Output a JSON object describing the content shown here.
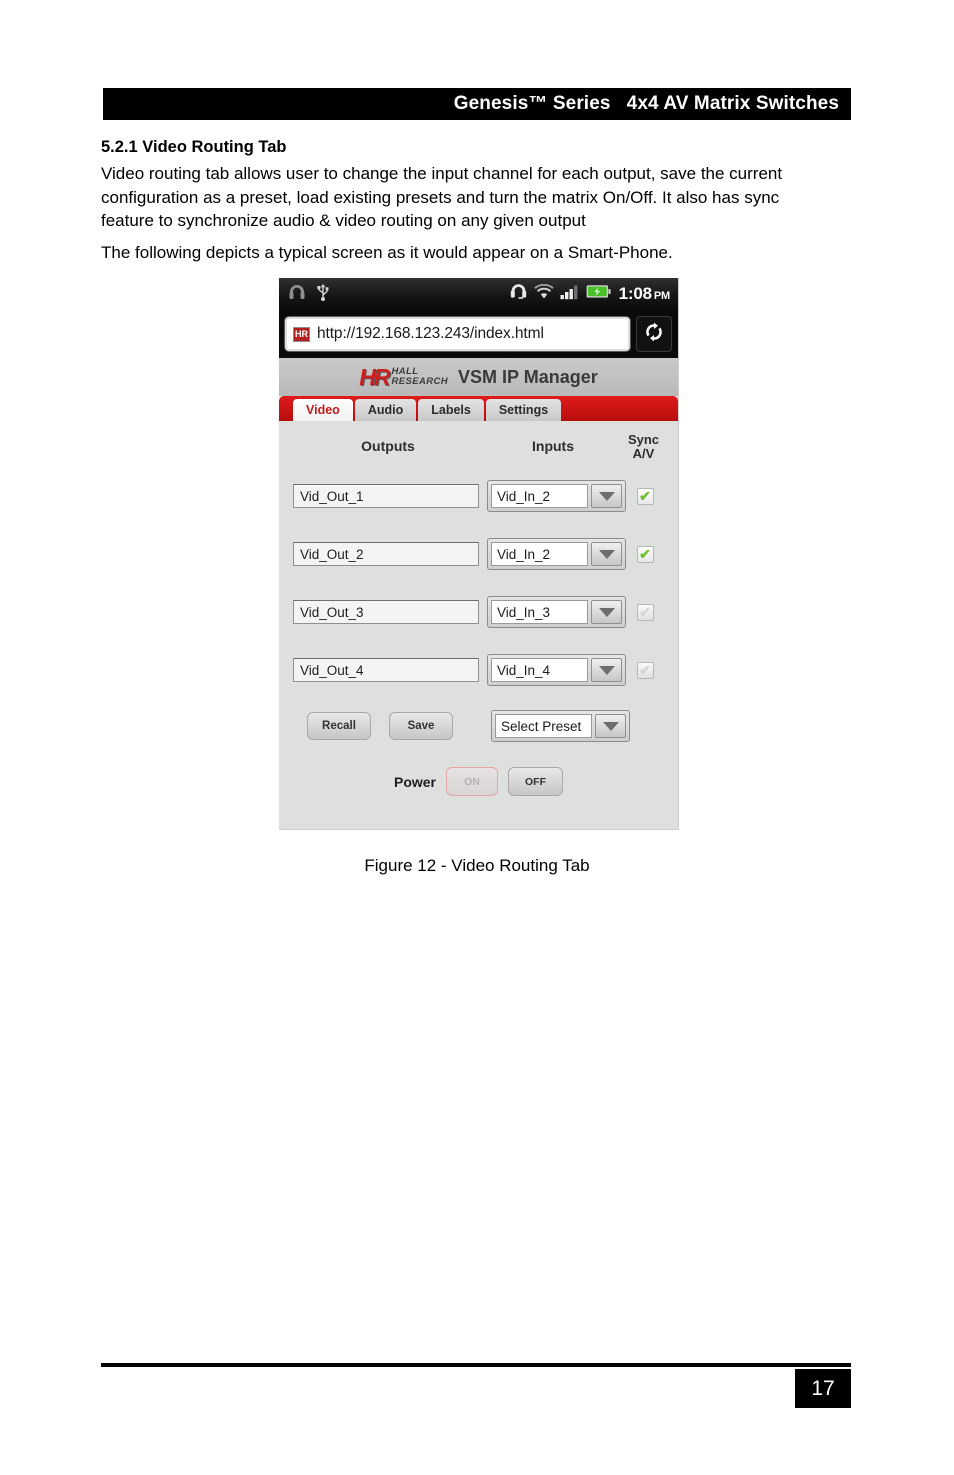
{
  "document": {
    "header_title": "Genesis™ Series   4x4 AV Matrix Switches",
    "section_heading": "5.2.1 Video Routing Tab",
    "paragraph_1": "Video routing tab allows user to change the input channel for each output, save the current configuration as a preset, load existing presets and turn the matrix On/Off. It also has sync feature to synchronize audio & video routing on any given output",
    "paragraph_2": "The following depicts a typical screen as it would appear on a Smart-Phone.",
    "figure_caption": "Figure 12 - Video Routing Tab",
    "page_number": "17"
  },
  "phone": {
    "status_bar": {
      "left_icons": [
        "headphone-icon",
        "usb-icon"
      ],
      "right_icons": [
        "headset-icon",
        "wifi-icon",
        "signal-bars-icon",
        "battery-charging-icon"
      ],
      "time": "1:08",
      "ampm": "PM"
    },
    "browser": {
      "favicon_label": "HR",
      "url": "http://192.168.123.243/index.html",
      "reload_icon": "reload-icon"
    },
    "brand": {
      "logo_mark": "HR",
      "logo_line1": "HALL",
      "logo_line2": "RESEARCH",
      "title": "VSM IP Manager"
    },
    "tabs": [
      {
        "label": "Video",
        "active": true
      },
      {
        "label": "Audio",
        "active": false
      },
      {
        "label": "Labels",
        "active": false
      },
      {
        "label": "Settings",
        "active": false
      }
    ],
    "columns": {
      "outputs": "Outputs",
      "inputs": "Inputs",
      "sync_line1": "Sync",
      "sync_line2": "A/V"
    },
    "rows": [
      {
        "output": "Vid_Out_1",
        "input": "Vid_In_2",
        "sync": true,
        "check": "✔"
      },
      {
        "output": "Vid_Out_2",
        "input": "Vid_In_2",
        "sync": true,
        "check": "✔"
      },
      {
        "output": "Vid_Out_3",
        "input": "Vid_In_3",
        "sync": false,
        "check": "✔"
      },
      {
        "output": "Vid_Out_4",
        "input": "Vid_In_4",
        "sync": false,
        "check": "✔"
      }
    ],
    "preset": {
      "recall_label": "Recall",
      "save_label": "Save",
      "select_value": "Select Preset"
    },
    "power": {
      "label": "Power",
      "on_label": "ON",
      "off_label": "OFF"
    },
    "colors": {
      "brand_red": "#cc1f1f",
      "tab_bar_red": "#d01616",
      "app_background": "#dde0dc",
      "check_green": "#6fbf2f"
    }
  }
}
